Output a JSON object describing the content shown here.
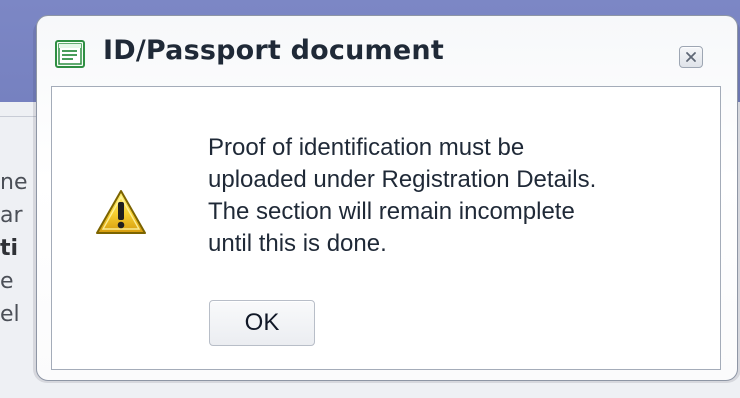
{
  "background": {
    "fragments": [
      {
        "text": "ne",
        "bold": false
      },
      {
        "text": "ar",
        "bold": false
      },
      {
        "text": "ti",
        "bold": true
      },
      {
        "text": "e",
        "bold": false
      },
      {
        "text": "el",
        "bold": false
      }
    ]
  },
  "dialog": {
    "title": "ID/Passport document",
    "icon": "document-window-icon",
    "close_icon": "close-icon",
    "warning_icon": "warning-icon",
    "message_lines": [
      "Proof of identification must be",
      "uploaded under Registration Details.",
      "The section will remain incomplete",
      "until this is done."
    ],
    "ok_label": "OK"
  },
  "colors": {
    "header_purple": "#7c87c5",
    "dialog_border": "#8e96a5",
    "panel_border": "#a4acb9",
    "text_dark": "#1f2937",
    "warning_yellow": "#f2c229",
    "warning_outline": "#806400"
  }
}
